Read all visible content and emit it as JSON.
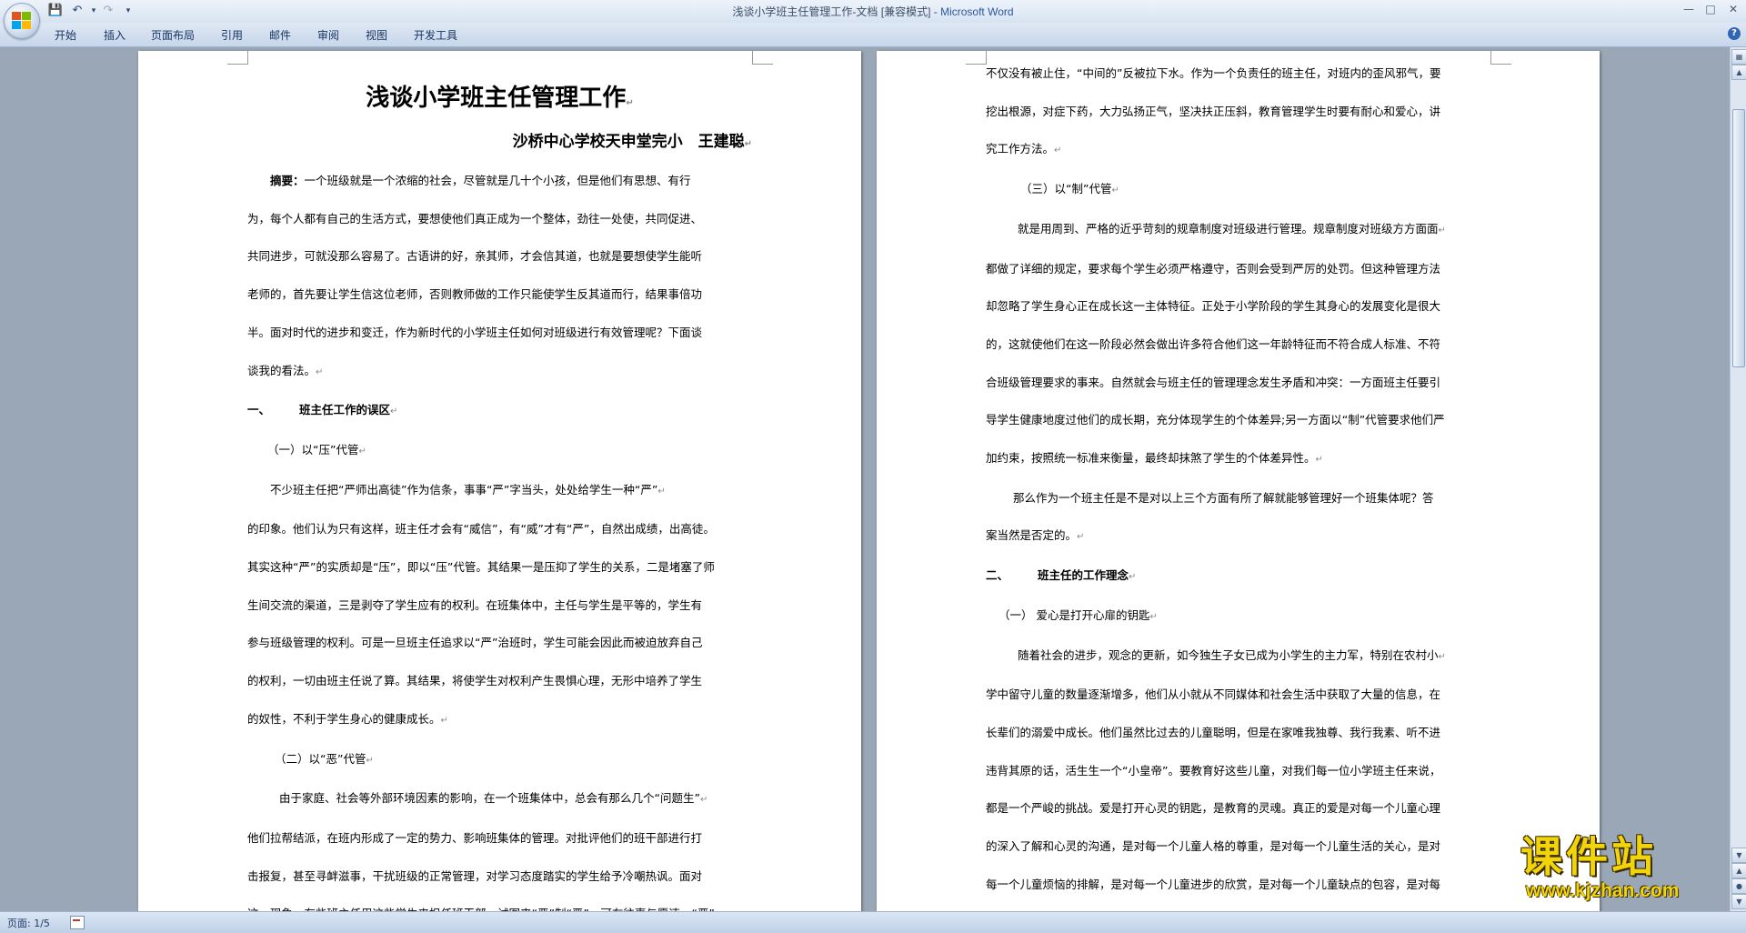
{
  "window": {
    "title_doc": "浅谈小学班主任管理工作-文档 [兼容模式] - ",
    "title_app": "Microsoft Word"
  },
  "ribbon": {
    "tabs": [
      "开始",
      "插入",
      "页面布局",
      "引用",
      "邮件",
      "审阅",
      "视图",
      "开发工具"
    ]
  },
  "left_page": {
    "title": "浅谈小学班主任管理工作",
    "author": "沙桥中心学校天申堂完小　王建聪",
    "abstract_label": "摘要：",
    "lines": [
      "一个班级就是一个浓缩的社会，尽管就是几十个小孩，但是他们有思想、有行",
      "为，每个人都有自己的生活方式，要想使他们真正成为一个整体，劲往一处使，共同促进、",
      "共同进步，可就没那么容易了。古语讲的好，亲其师，才会信其道，也就是要想使学生能听",
      "老师的，首先要让学生信这位老师，否则教师做的工作只能使学生反其道而行，结果事倍功",
      "半。面对时代的进步和变迁，作为新时代的小学班主任如何对班级进行有效管理呢？下面谈",
      "谈我的看法。"
    ],
    "heading1_num": "一、",
    "heading1": "班主任工作的误区",
    "sub1": "（一）以“压”代管",
    "para1": [
      "不少班主任把“严师出高徒”作为信条，事事“严”字当头，处处给学生一种“严”",
      "的印象。他们认为只有这样，班主任才会有“威信”，有“威”才有“严”，自然出成绩，出高徒。",
      "其实这种“严”的实质却是“压”，即以“压”代管。其结果一是压抑了学生的关系，二是堵塞了师",
      "生间交流的渠道，三是剥夺了学生应有的权利。在班集体中，主任与学生是平等的，学生有",
      "参与班级管理的权利。可是一旦班主任追求以“严”治班时，学生可能会因此而被迫放弃自己",
      "的权利，一切由班主任说了算。其结果，将使学生对权利产生畏惧心理，无形中培养了学生",
      "的奴性，不利于学生身心的健康成长。"
    ],
    "sub2": "（二）以“恶”代管",
    "para2": [
      "由于家庭、社会等外部环境因素的影响，在一个班集体中，总会有那么几个“问题生”",
      "他们拉帮结派，在班内形成了一定的势力、影响班集体的管理。对批评他们的班干部进行打",
      "击报复，甚至寻衅滋事，干扰班级的正常管理，对学习态度踏实的学生给予冷嘲热讽。面对",
      "这一现象，有些班主任用这些学生来担任班干部，试图来“恶”制“恶”。可在往事与愿违，“恶”"
    ]
  },
  "right_page": {
    "lines1": [
      "不仅没有被止住，“中间的”反被拉下水。作为一个负责任的班主任，对班内的歪风邪气，要",
      "挖出根源，对症下药，大力弘扬正气，坚决扶正压斜，教育管理学生时要有耐心和爱心，讲",
      "究工作方法。"
    ],
    "sub3": "（三）以“制”代管",
    "para3": [
      "就是用周到、严格的近乎苛刻的规章制度对班级进行管理。规章制度对班级方方面面",
      "都做了详细的规定，要求每个学生必须严格遵守，否则会受到严厉的处罚。但这种管理方法",
      "却忽略了学生身心正在成长这一主体特征。正处于小学阶段的学生其身心的发展变化是很大",
      "的，这就使他们在这一阶段必然会做出许多符合他们这一年龄特征而不符合成人标准、不符",
      "合班级管理要求的事来。自然就会与班主任的管理理念发生矛盾和冲突：一方面班主任要引",
      "导学生健康地度过他们的成长期，充分体现学生的个体差异;另一方面以“制”代管要求他们严",
      "加约束，按照统一标准来衡量，最终却抹煞了学生的个体差异性。"
    ],
    "para4": [
      "那么作为一个班主任是不是对以上三个方面有所了解就能够管理好一个班集体呢？答",
      "案当然是否定的。"
    ],
    "heading2_num": "二、",
    "heading2": "班主任的工作理念",
    "sub4": "（一） 爱心是打开心扉的钥匙",
    "para5": [
      "随着社会的进步，观念的更新，如今独生子女已成为小学生的主力军，特别在农村小",
      "学中留守儿童的数量逐渐增多，他们从小就从不同媒体和社会生活中获取了大量的信息，在",
      "长辈们的溺爱中成长。他们虽然比过去的儿童聪明，但是在家唯我独尊、我行我素、听不进",
      "违背其原的话，活生生一个“小皇帝”。要教育好这些儿童，对我们每一位小学班主任来说，",
      "都是一个严峻的挑战。爱是打开心灵的钥匙，是教育的灵魂。真正的爱是对每一个儿童心理",
      "的深入了解和心灵的沟通，是对每一个儿童人格的尊重，是对每一个儿童生活的关心，是对",
      "每一个儿童烦恼的排解，是对每一个儿童进步的欣赏，是对每一个儿童缺点的包容，是对每"
    ]
  },
  "status": {
    "page_label": "页面: 1/5"
  },
  "watermark": {
    "main": "课件站",
    "url": "www.kjzhan.com"
  }
}
